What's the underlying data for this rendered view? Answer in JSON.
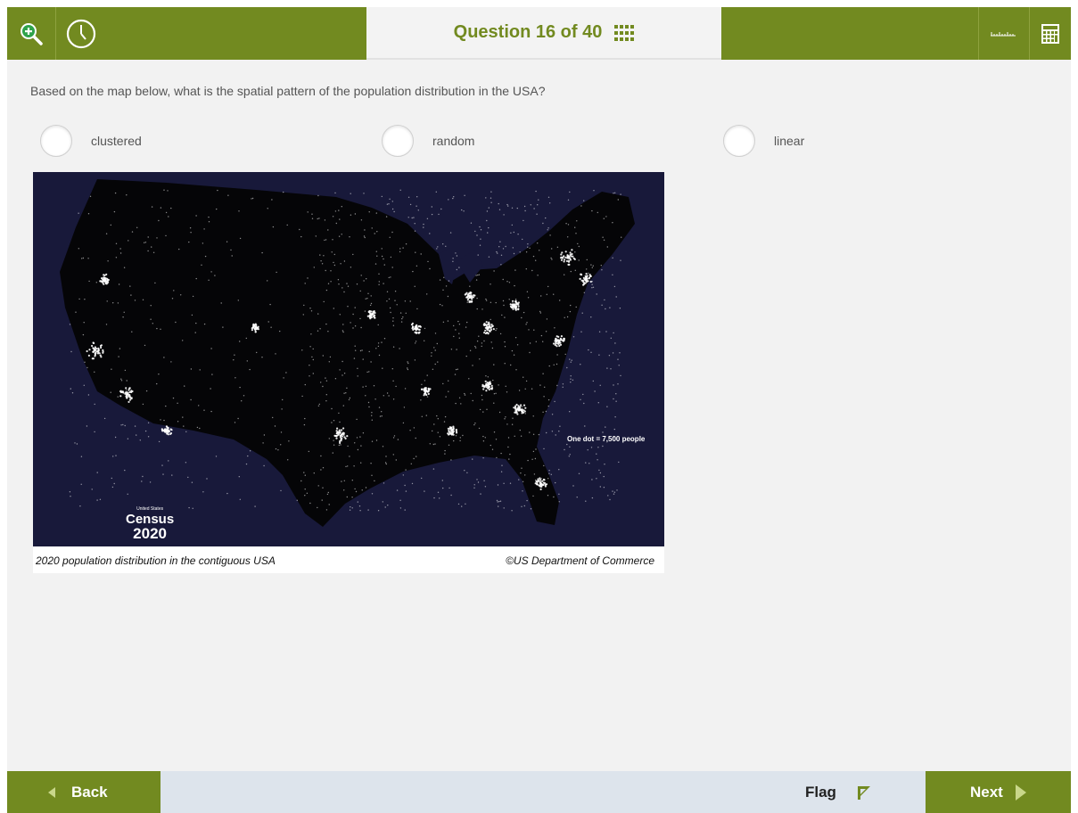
{
  "header": {
    "question_counter": "Question 16 of 40",
    "accent_color": "#728a20",
    "icons": [
      "zoom-in-icon",
      "clock-icon",
      "grid-icon",
      "ruler-icon",
      "calculator-icon"
    ]
  },
  "question": {
    "text": "Based on the map below, what is the spatial pattern of the population distribution in the USA?",
    "options": [
      {
        "label": "clustered"
      },
      {
        "label": "random"
      },
      {
        "label": "linear"
      }
    ]
  },
  "figure": {
    "legend_note": "One dot = 7,500 people",
    "logo_small_text": "United States",
    "logo_word": "Census",
    "logo_year": "2020",
    "caption_left": "2020 population distribution in the contiguous USA",
    "caption_right": "©US Department of Commerce",
    "map_background": "#18193a"
  },
  "footer": {
    "back_label": "Back",
    "flag_label": "Flag",
    "next_label": "Next"
  }
}
